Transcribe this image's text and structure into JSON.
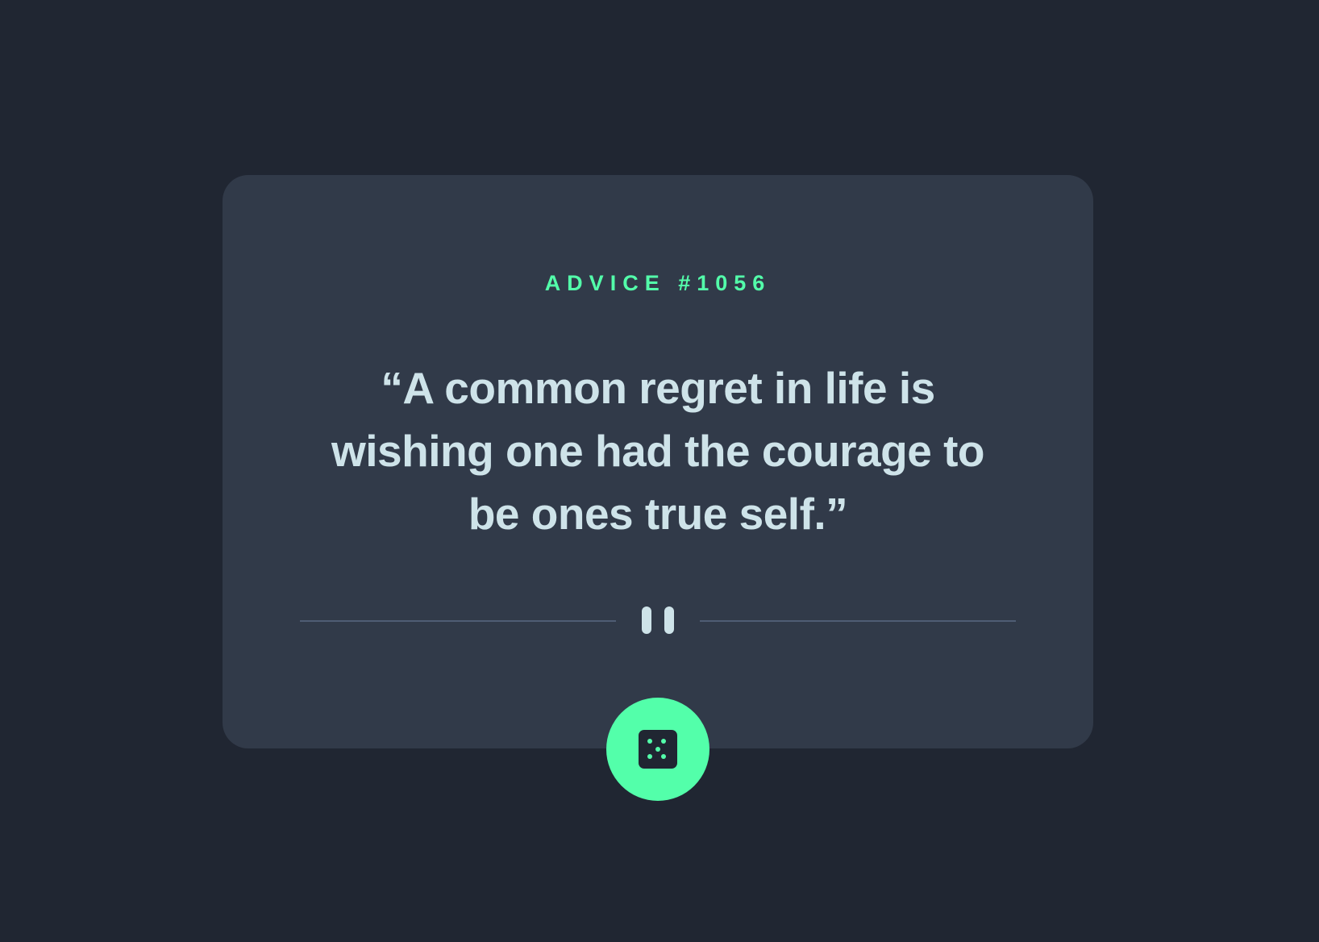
{
  "advice": {
    "id_label": "ADVICE #1056",
    "quote": "“A common regret in life is wishing one had the courage to be ones true self.”"
  },
  "divider": {
    "icon": "pause-icon"
  },
  "actions": {
    "generate_icon": "dice-icon"
  },
  "colors": {
    "background": "#202632",
    "card": "#313a49",
    "accent": "#53ffaa",
    "text": "#cee3e9",
    "divider_line": "#4f5d74"
  }
}
